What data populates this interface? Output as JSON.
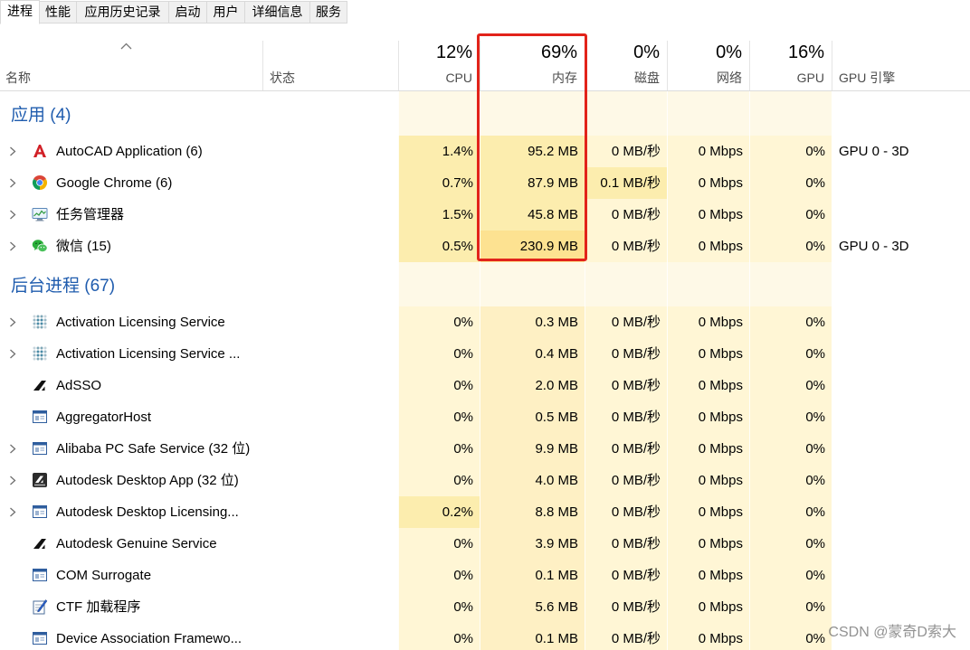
{
  "tabs": [
    {
      "label": "进程",
      "selected": true
    },
    {
      "label": "性能"
    },
    {
      "label": "应用历史记录"
    },
    {
      "label": "启动"
    },
    {
      "label": "用户"
    },
    {
      "label": "详细信息"
    },
    {
      "label": "服务"
    }
  ],
  "header": {
    "sort_icon": "chevron-up-icon",
    "name_label": "名称",
    "status_label": "状态",
    "cpu": {
      "percent": "12%",
      "label": "CPU"
    },
    "memory": {
      "percent": "69%",
      "label": "内存"
    },
    "disk": {
      "percent": "0%",
      "label": "磁盘"
    },
    "network": {
      "percent": "0%",
      "label": "网络"
    },
    "gpu": {
      "percent": "16%",
      "label": "GPU"
    },
    "gpu_engine_label": "GPU 引擎"
  },
  "groups": [
    {
      "title": "应用 (4)",
      "rows": [
        {
          "name": "AutoCAD Application (6)",
          "icon": "autocad-icon",
          "expandable": true,
          "cpu": "1.4%",
          "memory": "95.2 MB",
          "disk": "0 MB/秒",
          "network": "0 Mbps",
          "gpu": "0%",
          "gpu_engine": "GPU 0 - 3D"
        },
        {
          "name": "Google Chrome (6)",
          "icon": "chrome-icon",
          "expandable": true,
          "cpu": "0.7%",
          "memory": "87.9 MB",
          "disk": "0.1 MB/秒",
          "network": "0 Mbps",
          "gpu": "0%"
        },
        {
          "name": "任务管理器",
          "icon": "task-manager-icon",
          "expandable": true,
          "cpu": "1.5%",
          "memory": "45.8 MB",
          "disk": "0 MB/秒",
          "network": "0 Mbps",
          "gpu": "0%"
        },
        {
          "name": "微信 (15)",
          "icon": "wechat-icon",
          "expandable": true,
          "cpu": "0.5%",
          "memory": "230.9 MB",
          "disk": "0 MB/秒",
          "network": "0 Mbps",
          "gpu": "0%",
          "gpu_engine": "GPU 0 - 3D"
        }
      ]
    },
    {
      "title": "后台进程 (67)",
      "rows": [
        {
          "name": "Activation Licensing Service",
          "icon": "licensing-dots-icon",
          "expandable": true,
          "cpu": "0%",
          "memory": "0.3 MB",
          "disk": "0 MB/秒",
          "network": "0 Mbps",
          "gpu": "0%"
        },
        {
          "name": "Activation Licensing Service ...",
          "icon": "licensing-dots-icon",
          "expandable": true,
          "cpu": "0%",
          "memory": "0.4 MB",
          "disk": "0 MB/秒",
          "network": "0 Mbps",
          "gpu": "0%"
        },
        {
          "name": "AdSSO",
          "icon": "autodesk-logo-icon",
          "expandable": false,
          "cpu": "0%",
          "memory": "2.0 MB",
          "disk": "0 MB/秒",
          "network": "0 Mbps",
          "gpu": "0%"
        },
        {
          "name": "AggregatorHost",
          "icon": "app-window-icon",
          "expandable": false,
          "cpu": "0%",
          "memory": "0.5 MB",
          "disk": "0 MB/秒",
          "network": "0 Mbps",
          "gpu": "0%"
        },
        {
          "name": "Alibaba PC Safe Service (32 位)",
          "icon": "app-window-icon",
          "expandable": true,
          "cpu": "0%",
          "memory": "9.9 MB",
          "disk": "0 MB/秒",
          "network": "0 Mbps",
          "gpu": "0%"
        },
        {
          "name": "Autodesk Desktop App (32 位)",
          "icon": "autodesk-app-icon",
          "expandable": true,
          "cpu": "0%",
          "memory": "4.0 MB",
          "disk": "0 MB/秒",
          "network": "0 Mbps",
          "gpu": "0%"
        },
        {
          "name": "Autodesk Desktop Licensing...",
          "icon": "app-window-icon",
          "expandable": true,
          "cpu": "0.2%",
          "memory": "8.8 MB",
          "disk": "0 MB/秒",
          "network": "0 Mbps",
          "gpu": "0%"
        },
        {
          "name": "Autodesk Genuine Service",
          "icon": "autodesk-logo-icon",
          "expandable": false,
          "cpu": "0%",
          "memory": "3.9 MB",
          "disk": "0 MB/秒",
          "network": "0 Mbps",
          "gpu": "0%"
        },
        {
          "name": "COM Surrogate",
          "icon": "app-window-icon",
          "expandable": false,
          "cpu": "0%",
          "memory": "0.1 MB",
          "disk": "0 MB/秒",
          "network": "0 Mbps",
          "gpu": "0%"
        },
        {
          "name": "CTF 加载程序",
          "icon": "ctf-pen-icon",
          "expandable": false,
          "cpu": "0%",
          "memory": "5.6 MB",
          "disk": "0 MB/秒",
          "network": "0 Mbps",
          "gpu": "0%"
        },
        {
          "name": "Device Association Framewo...",
          "icon": "app-window-icon",
          "expandable": false,
          "cpu": "0%",
          "memory": "0.1 MB",
          "disk": "0 MB/秒",
          "network": "0 Mbps",
          "gpu": "0%"
        }
      ]
    }
  ],
  "colors": {
    "group_title": "#1f5cae",
    "heat_group": "#fef9e7",
    "heat_low": "#fff6d5",
    "heat_low_memory": "#fef0c4",
    "heat_mid": "#fcedae",
    "heat_high": "#fde291",
    "highlight_box": "#e2231a"
  },
  "watermark": "CSDN @蒙奇D索大"
}
